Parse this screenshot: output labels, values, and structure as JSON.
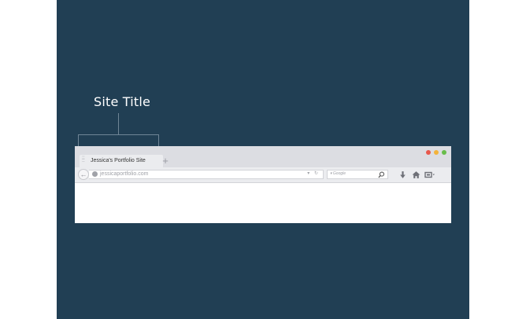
{
  "annotation": {
    "title": "Site Title"
  },
  "browser": {
    "tab": {
      "title": "Jessica's Portfolio Site"
    },
    "new_tab_symbol": "+",
    "back_symbol": "←",
    "address_bar": {
      "url": "jessicaportfolio.com",
      "controls": "▾ ↻"
    },
    "search_bar": {
      "engine": "▾ Google"
    },
    "window_controls": [
      {
        "name": "close",
        "color": "#e8584c"
      },
      {
        "name": "minimize",
        "color": "#f3b33b"
      },
      {
        "name": "zoom",
        "color": "#68bd4a"
      }
    ],
    "toolbar_icons": [
      "download-icon",
      "home-icon",
      "extensions-icon"
    ]
  },
  "colors": {
    "background": "#213f54",
    "page": "#ffffff"
  }
}
